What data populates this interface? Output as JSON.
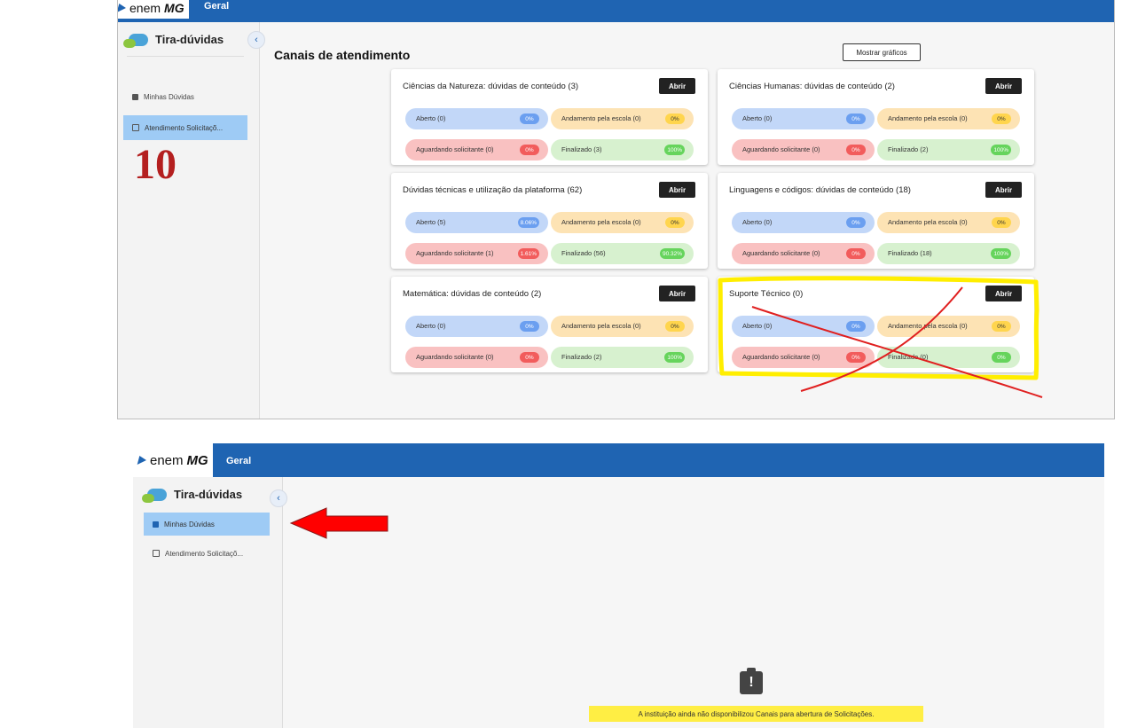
{
  "app": {
    "logo_text": "enem",
    "logo_bold": "MG",
    "nav_tab": "Geral"
  },
  "sidebar": {
    "title": "Tira-dúvidas",
    "collapse_icon": "chevron-left-icon",
    "items": [
      {
        "label": "Minhas Dúvidas",
        "icon": "square-icon"
      },
      {
        "label": "Atendimento Solicitaçõ...",
        "icon": "list-icon"
      }
    ]
  },
  "main": {
    "title": "Canais de atendimento",
    "toggle_button": "Mostrar gráficos",
    "open_button": "Abrir",
    "cards": [
      {
        "title": "Ciências da Natureza: dúvidas de conteúdo (3)",
        "statuses": [
          {
            "label": "Aberto (0)",
            "pct": "0%"
          },
          {
            "label": "Andamento pela escola (0)",
            "pct": "0%"
          },
          {
            "label": "Aguardando solicitante (0)",
            "pct": "0%"
          },
          {
            "label": "Finalizado (3)",
            "pct": "100%"
          }
        ]
      },
      {
        "title": "Ciências Humanas: dúvidas de conteúdo (2)",
        "statuses": [
          {
            "label": "Aberto (0)",
            "pct": "0%"
          },
          {
            "label": "Andamento pela escola (0)",
            "pct": "0%"
          },
          {
            "label": "Aguardando solicitante (0)",
            "pct": "0%"
          },
          {
            "label": "Finalizado (2)",
            "pct": "100%"
          }
        ]
      },
      {
        "title": "Dúvidas técnicas e utilização da plataforma (62)",
        "statuses": [
          {
            "label": "Aberto (5)",
            "pct": "8.06%"
          },
          {
            "label": "Andamento pela escola (0)",
            "pct": "0%"
          },
          {
            "label": "Aguardando solicitante (1)",
            "pct": "1.61%"
          },
          {
            "label": "Finalizado (56)",
            "pct": "90.32%"
          }
        ]
      },
      {
        "title": "Linguagens e códigos: dúvidas de conteúdo (18)",
        "statuses": [
          {
            "label": "Aberto (0)",
            "pct": "0%"
          },
          {
            "label": "Andamento pela escola (0)",
            "pct": "0%"
          },
          {
            "label": "Aguardando solicitante (0)",
            "pct": "0%"
          },
          {
            "label": "Finalizado (18)",
            "pct": "100%"
          }
        ]
      },
      {
        "title": "Matemática: dúvidas de conteúdo (2)",
        "statuses": [
          {
            "label": "Aberto (0)",
            "pct": "0%"
          },
          {
            "label": "Andamento pela escola (0)",
            "pct": "0%"
          },
          {
            "label": "Aguardando solicitante (0)",
            "pct": "0%"
          },
          {
            "label": "Finalizado (2)",
            "pct": "100%"
          }
        ]
      },
      {
        "title": "Suporte Técnico (0)",
        "statuses": [
          {
            "label": "Aberto (0)",
            "pct": "0%"
          },
          {
            "label": "Andamento pela escola (0)",
            "pct": "0%"
          },
          {
            "label": "Aguardando solicitante (0)",
            "pct": "0%"
          },
          {
            "label": "Finalizado (0)",
            "pct": "0%"
          }
        ]
      }
    ]
  },
  "annotation": {
    "number": "10",
    "highlight_color": "#ffee00",
    "cross_color": "#e02020",
    "arrow_color": "#ff0000"
  },
  "empty_state": {
    "icon": "clipboard-alert-icon",
    "glyph": "!",
    "message": "A instituição ainda não disponibilizou Canais para abertura de Solicitações."
  }
}
